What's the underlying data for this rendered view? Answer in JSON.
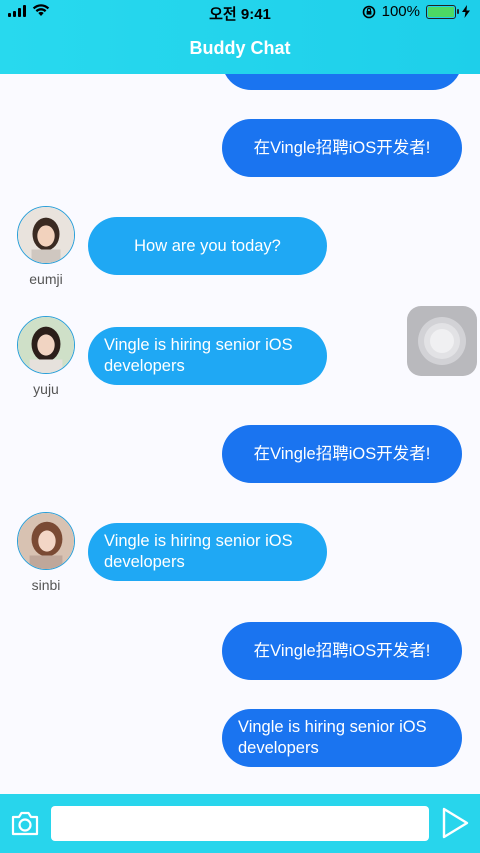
{
  "status": {
    "time": "오전 9:41",
    "battery": "100%"
  },
  "header": {
    "title": "Buddy Chat"
  },
  "messages": [
    {
      "dir": "out",
      "text": "在Vingle招聘iOS开发者!"
    },
    {
      "dir": "in",
      "sender": "eumji",
      "text": "How are you today?"
    },
    {
      "dir": "in",
      "sender": "yuju",
      "text": "Vingle is hiring senior iOS developers"
    },
    {
      "dir": "out",
      "text": "在Vingle招聘iOS开发者!"
    },
    {
      "dir": "in",
      "sender": "sinbi",
      "text": "Vingle is hiring senior iOS developers"
    },
    {
      "dir": "out",
      "text": "在Vingle招聘iOS开发者!"
    },
    {
      "dir": "out",
      "text": "Vingle is hiring senior iOS developers"
    }
  ],
  "composer": {
    "value": "",
    "placeholder": ""
  },
  "icons": {
    "camera": "camera-icon",
    "send": "send-icon",
    "assistive": "assistive-touch-icon"
  },
  "colors": {
    "header": "#28d9ee",
    "outgoing": "#1a74f0",
    "incoming": "#1fa8f4",
    "bottom_bar": "#28d5ec"
  }
}
